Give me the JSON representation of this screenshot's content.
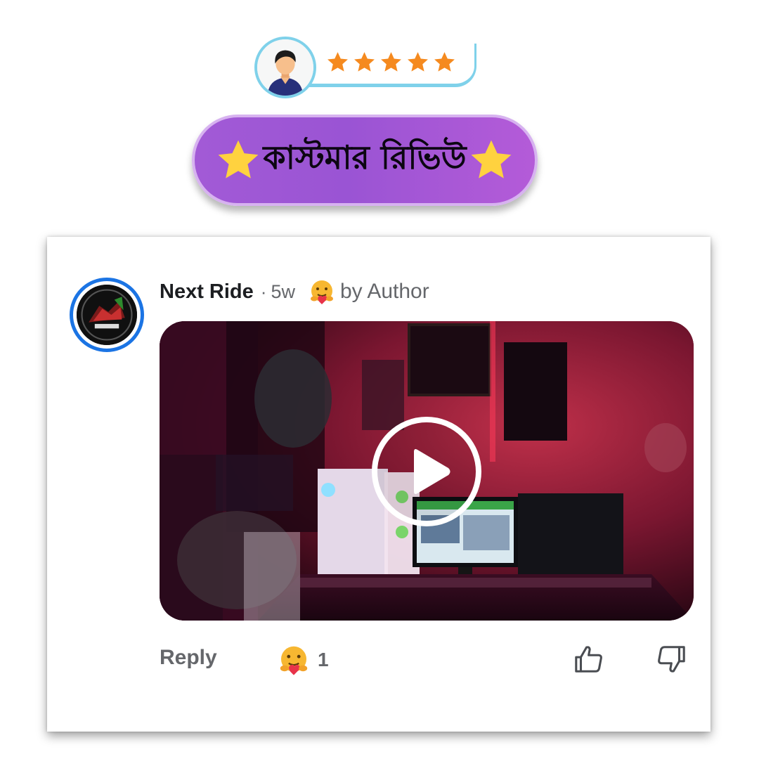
{
  "header": {
    "rating_stars": 5,
    "title": "কাস্টমার রিভিউ",
    "colors": {
      "star": "#f58a1f",
      "pill": "#a25ad6",
      "pill_star": "#ffd23f",
      "strip": "#7fd1ea"
    }
  },
  "comment": {
    "author": "Next Ride",
    "separator": "·",
    "time": "5w",
    "badge_label": "by Author",
    "badge_icon": "care-emoji-icon",
    "video_icon": "play-icon",
    "reply_label": "Reply",
    "reaction_icon": "care-emoji-icon",
    "reaction_count": "1",
    "like_icon": "thumbs-up-icon",
    "dislike_icon": "thumbs-down-icon",
    "colors": {
      "avatar_ring": "#1b74e4",
      "muted_text": "#65676b",
      "name_text": "#1c1e21"
    }
  }
}
